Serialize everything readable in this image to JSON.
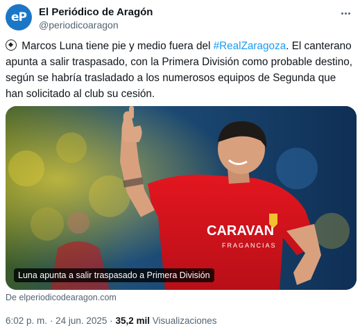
{
  "author": {
    "avatar_text": "eP",
    "name": "El Periódico de Aragón",
    "handle": "@periodicoaragon"
  },
  "tweet": {
    "text_before": "Marcos Luna tiene pie y medio fuera del ",
    "hashtag": "#RealZaragoza",
    "text_after": ". El canterano apunta a salir traspasado, con la Primera División como probable destino, según se habría trasladado a los numerosos equipos de Segunda que han solicitado al club su cesión."
  },
  "media": {
    "caption": "Luna apunta a salir traspasado a Primera División",
    "shirt_sponsor": "CARAVAN",
    "shirt_sponsor_sub": "FRAGANCIAS"
  },
  "link_source": "De elperiodicodearagon.com",
  "meta": {
    "time": "6:02 p. m.",
    "separator": "·",
    "date": "24 jun. 2025",
    "views_count": "35,2 mil",
    "views_label": "Visualizaciones"
  },
  "colors": {
    "accent": "#1d9bf0",
    "avatar_bg": "#1b77c5",
    "shirt_red": "#e0141e"
  },
  "icons": [
    "soccer-ball-icon",
    "more-options-icon"
  ]
}
